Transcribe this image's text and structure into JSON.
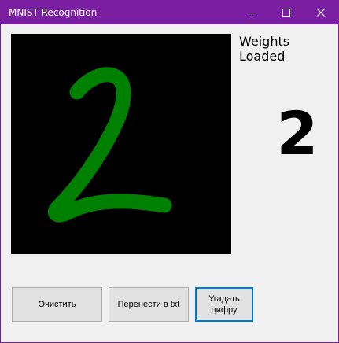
{
  "window": {
    "title": "MNIST Recognition"
  },
  "canvas": {
    "background": "#000000",
    "stroke_color": "#008000",
    "drawn_digit": "2"
  },
  "status": {
    "text": "Weights Loaded"
  },
  "prediction": {
    "digit": "2"
  },
  "buttons": {
    "clear": "Очистить",
    "save_txt": "Перенести в txt",
    "guess": "Угадать цифру"
  },
  "icons": {
    "minimize": "minimize-icon",
    "maximize": "maximize-icon",
    "close": "close-icon"
  },
  "colors": {
    "titlebar": "#7b1fa2",
    "accent_focus": "#0078d7"
  }
}
